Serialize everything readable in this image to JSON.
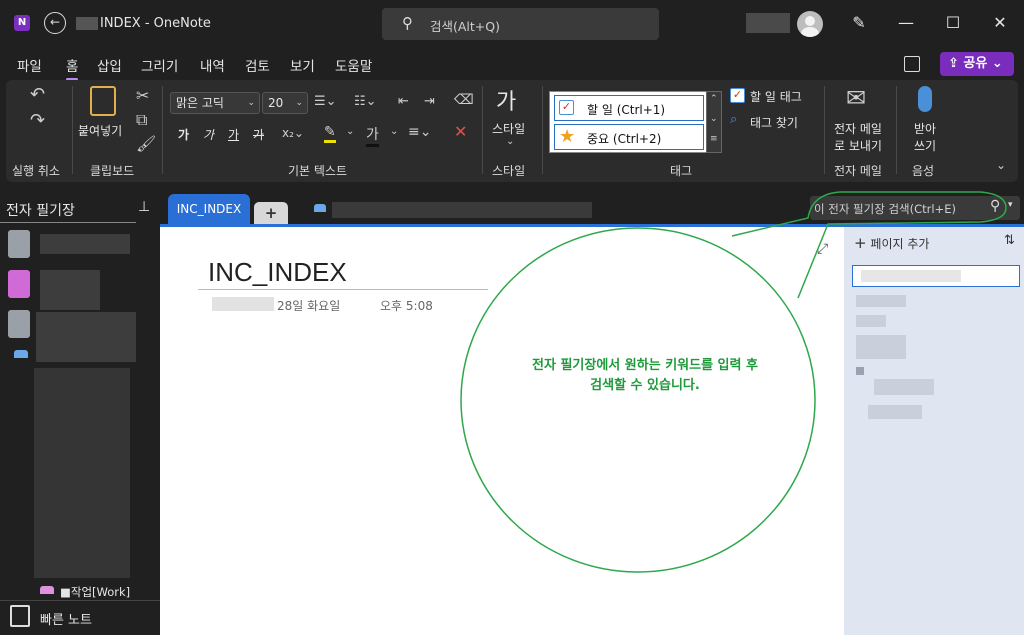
{
  "titlebar": {
    "title": "INDEX - OneNote",
    "search_placeholder": "검색(Alt+Q)",
    "minimize": "—",
    "maximize": "☐",
    "close": "✕"
  },
  "menu": {
    "tabs": [
      "파일",
      "홈",
      "삽입",
      "그리기",
      "내역",
      "검토",
      "보기",
      "도움말"
    ],
    "active": "홈",
    "share_label": "공유"
  },
  "ribbon": {
    "undo_group": "실행 취소",
    "clipboard": {
      "paste": "붙여넣기",
      "group": "클립보드"
    },
    "basic_text": {
      "font": "맑은 고딕",
      "size": "20",
      "group": "기본 텍스트",
      "styles": [
        "가",
        "가",
        "가",
        "가"
      ]
    },
    "style": {
      "label": "스타일",
      "group": "스타일"
    },
    "tags": {
      "items": [
        {
          "label": "할 일 (Ctrl+1)",
          "icon": "checkbox-icon"
        },
        {
          "label": "중요 (Ctrl+2)",
          "icon": "star-icon"
        }
      ],
      "todo_tag": "할 일 태그",
      "find_tags": "태그 찾기",
      "group": "태그"
    },
    "email": {
      "line1": "전자 메일",
      "line2": "로 보내기",
      "group": "전자 메일"
    },
    "voice": {
      "line1": "받아",
      "line2": "쓰기",
      "group": "음성"
    }
  },
  "left_pane": {
    "title": "전자 필기장",
    "section_item": "■작업[Work]",
    "quick_notes": "빠른 노트"
  },
  "section_tabs": {
    "active": "INC_INDEX",
    "add": "+"
  },
  "notebook_search": {
    "placeholder": "이 전자 필기장 검색(Ctrl+E)"
  },
  "page": {
    "title": "INC_INDEX",
    "date": "28일 화요일",
    "time": "오후 5:08"
  },
  "pages_pane": {
    "add_page": "페이지 추가"
  },
  "callout": {
    "line1": "전자 필기장에서 원하는 키워드를 입력 후",
    "line2": "검색할 수 있습니다."
  },
  "colors": {
    "accent_purple": "#7a2dbd",
    "section_blue": "#2a6fd6",
    "callout_green": "#1f9a3a"
  }
}
